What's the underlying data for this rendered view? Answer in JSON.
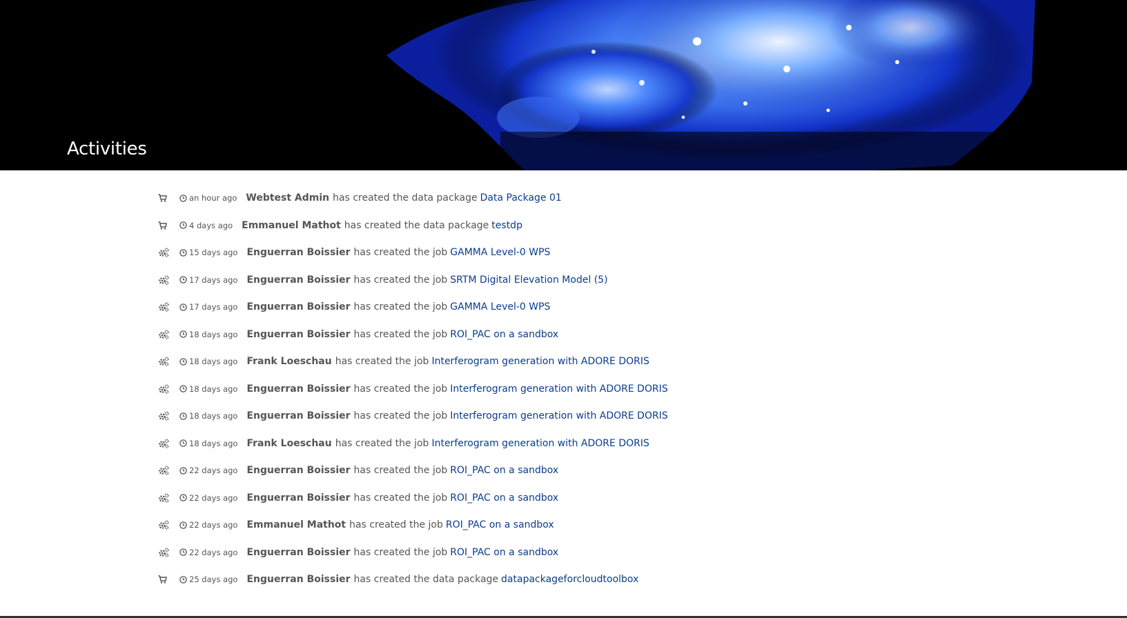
{
  "header": {
    "title": "Activities"
  },
  "activities": [
    {
      "icon": "cart-icon",
      "time": "an hour ago",
      "actor": "Webtest Admin",
      "action": "has created the data package",
      "target": "Data Package 01"
    },
    {
      "icon": "cart-icon",
      "time": "4 days ago",
      "actor": "Emmanuel Mathot",
      "action": "has created the data package",
      "target": "testdp"
    },
    {
      "icon": "gears-icon",
      "time": "15 days ago",
      "actor": "Enguerran Boissier",
      "action": "has created the job",
      "target": "GAMMA Level-0 WPS"
    },
    {
      "icon": "gears-icon",
      "time": "17 days ago",
      "actor": "Enguerran Boissier",
      "action": "has created the job",
      "target": "SRTM Digital Elevation Model (5)"
    },
    {
      "icon": "gears-icon",
      "time": "17 days ago",
      "actor": "Enguerran Boissier",
      "action": "has created the job",
      "target": "GAMMA Level-0 WPS"
    },
    {
      "icon": "gears-icon",
      "time": "18 days ago",
      "actor": "Enguerran Boissier",
      "action": "has created the job",
      "target": "ROI_PAC on a sandbox"
    },
    {
      "icon": "gears-icon",
      "time": "18 days ago",
      "actor": "Frank Loeschau",
      "action": "has created the job",
      "target": "Interferogram generation with ADORE DORIS"
    },
    {
      "icon": "gears-icon",
      "time": "18 days ago",
      "actor": "Enguerran Boissier",
      "action": "has created the job",
      "target": "Interferogram generation with ADORE DORIS"
    },
    {
      "icon": "gears-icon",
      "time": "18 days ago",
      "actor": "Enguerran Boissier",
      "action": "has created the job",
      "target": "Interferogram generation with ADORE DORIS"
    },
    {
      "icon": "gears-icon",
      "time": "18 days ago",
      "actor": "Frank Loeschau",
      "action": "has created the job",
      "target": "Interferogram generation with ADORE DORIS"
    },
    {
      "icon": "gears-icon",
      "time": "22 days ago",
      "actor": "Enguerran Boissier",
      "action": "has created the job",
      "target": "ROI_PAC on a sandbox"
    },
    {
      "icon": "gears-icon",
      "time": "22 days ago",
      "actor": "Enguerran Boissier",
      "action": "has created the job",
      "target": "ROI_PAC on a sandbox"
    },
    {
      "icon": "gears-icon",
      "time": "22 days ago",
      "actor": "Emmanuel Mathot",
      "action": "has created the job",
      "target": "ROI_PAC on a sandbox"
    },
    {
      "icon": "gears-icon",
      "time": "22 days ago",
      "actor": "Enguerran Boissier",
      "action": "has created the job",
      "target": "ROI_PAC on a sandbox"
    },
    {
      "icon": "cart-icon",
      "time": "25 days ago",
      "actor": "Enguerran Boissier",
      "action": "has created the data package",
      "target": "datapackageforcloudtoolbox"
    }
  ],
  "colors": {
    "link": "#0a3c8c",
    "text": "#555555",
    "banner_bg": "#000000",
    "banner_glow": "#2a6cff"
  }
}
